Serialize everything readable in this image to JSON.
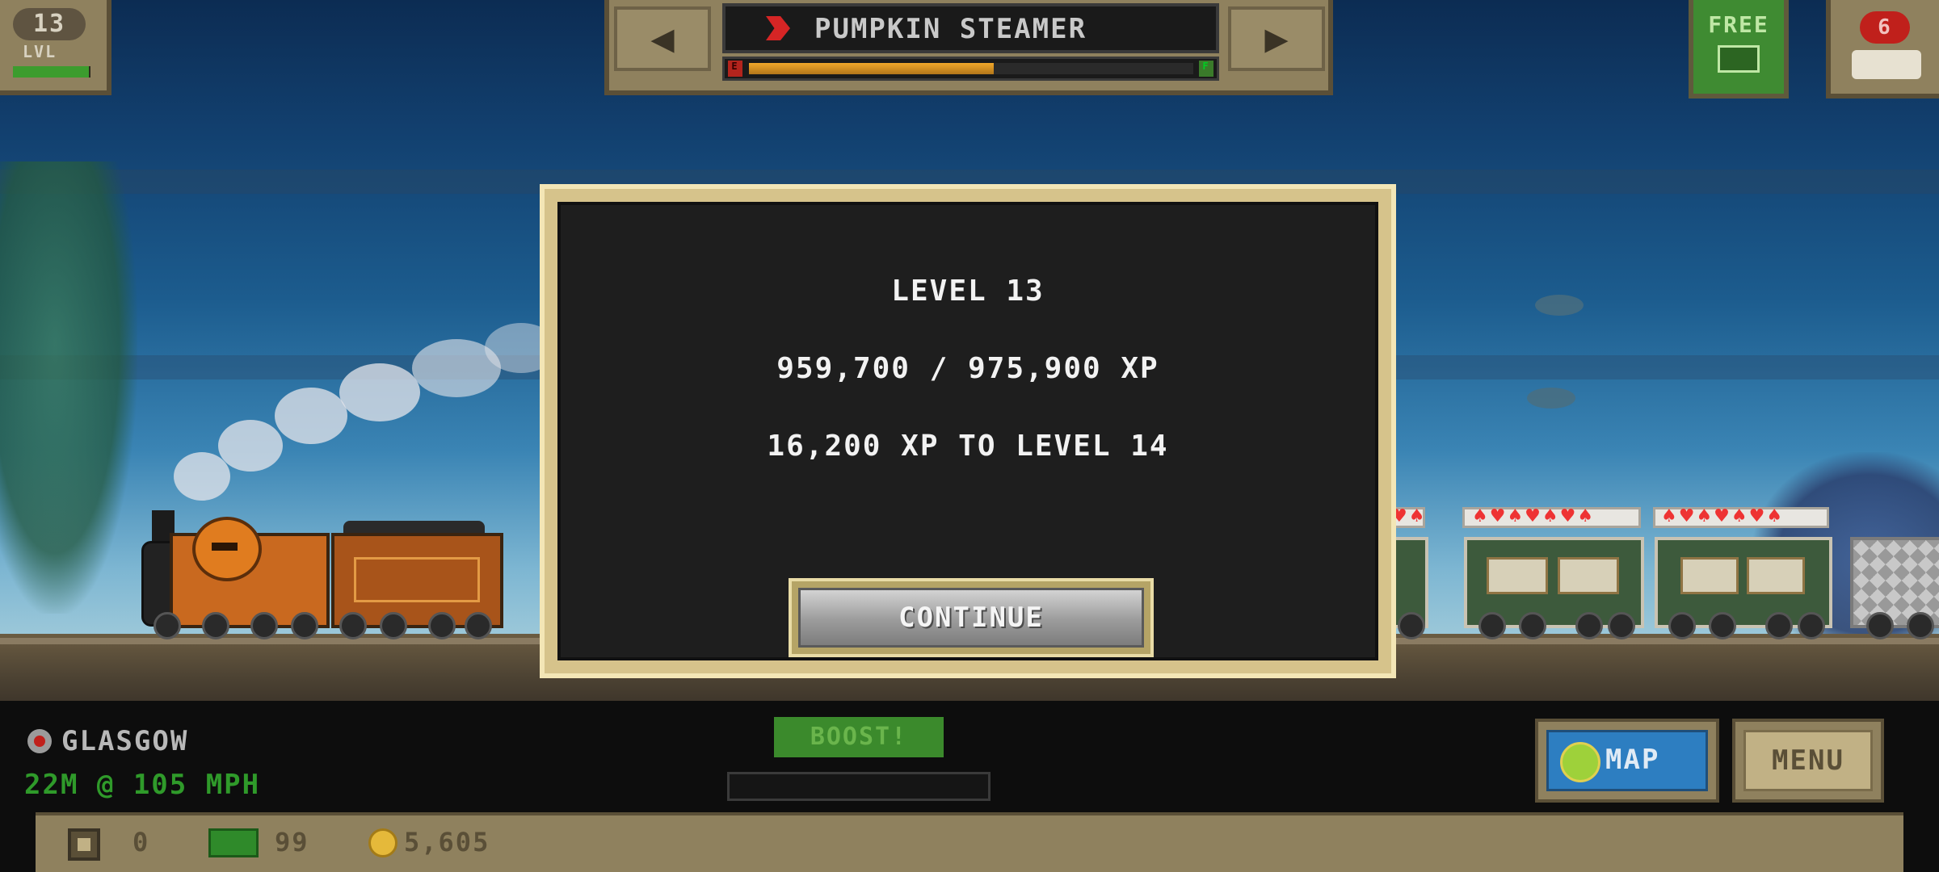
{
  "hud": {
    "level": {
      "number": "13",
      "tag": "LVL",
      "progress": 0.9834
    },
    "train": {
      "name": "PUMPKIN STEAMER",
      "prev_icon": "left-arrow-icon",
      "next_icon": "right-arrow-icon",
      "fuel_empty": "E",
      "fuel_full": "F",
      "fuel_level": 0.55
    },
    "free_button": {
      "label": "FREE"
    },
    "cars_button": {
      "count": "6"
    }
  },
  "modal": {
    "title": "LEVEL 13",
    "xp_progress": "959,700 / 975,900 XP",
    "xp_remaining": "16,200 XP TO LEVEL 14",
    "continue_label": "CONTINUE"
  },
  "bottom": {
    "station": "GLASGOW",
    "speed": "22M @ 105 MPH",
    "boost_label": "BOOST!",
    "map_label": "MAP",
    "menu_label": "MENU"
  },
  "resources": {
    "crates": "0",
    "bux": "99",
    "coins": "5,605"
  },
  "colors": {
    "modal_border": "#d6c38b",
    "modal_bg": "#1e1e1e",
    "speed_text": "#2f9a2a",
    "fuel": "#f0a72a",
    "free_button": "#3f8b32"
  }
}
